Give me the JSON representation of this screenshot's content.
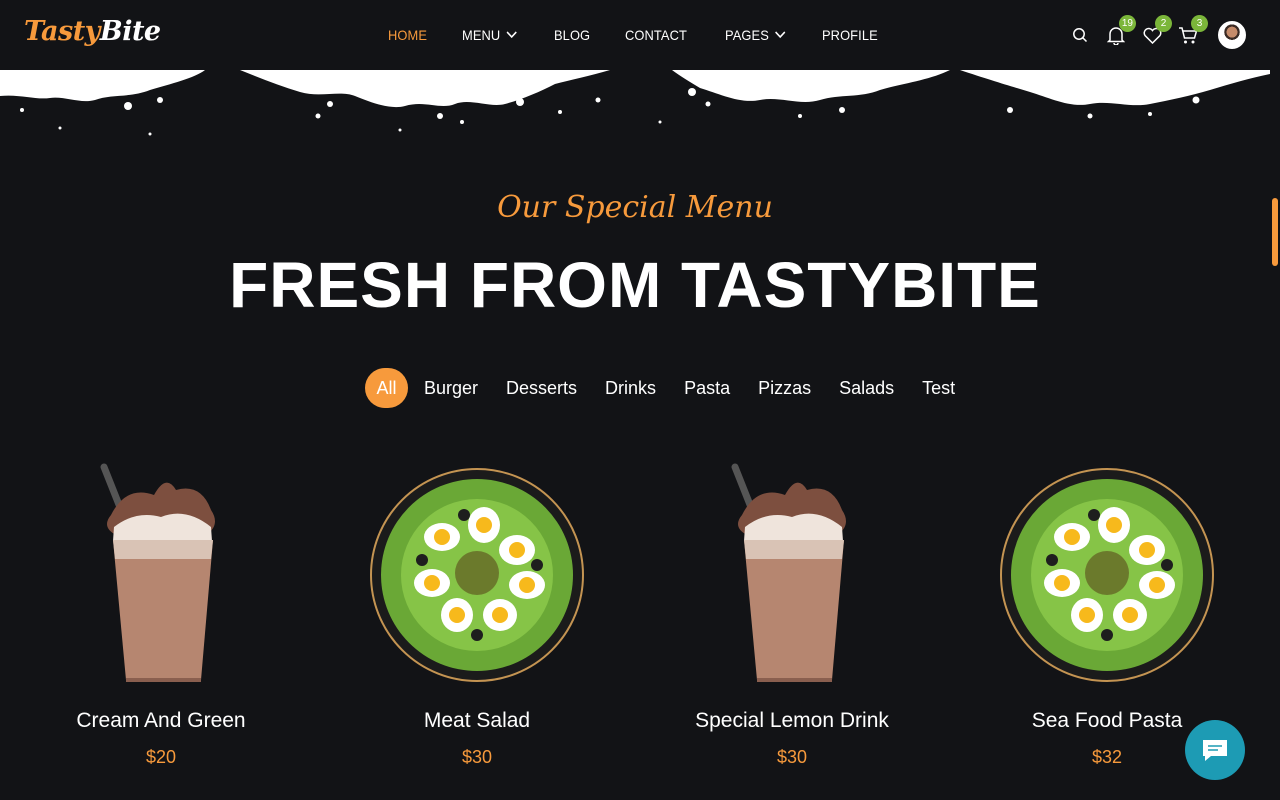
{
  "header": {
    "logo": {
      "part1": "Tasty",
      "part2": "Bite"
    },
    "nav": [
      {
        "label": "HOME",
        "active": true
      },
      {
        "label": "MENU",
        "dropdown": true
      },
      {
        "label": "BLOG"
      },
      {
        "label": "CONTACT"
      },
      {
        "label": "PAGES",
        "dropdown": true
      },
      {
        "label": "PROFILE"
      }
    ],
    "icons": {
      "search": "search-icon",
      "notifications": {
        "icon": "bell-icon",
        "count": "19"
      },
      "wishlist": {
        "icon": "heart-icon",
        "count": "2"
      },
      "cart": {
        "icon": "cart-icon",
        "count": "3"
      },
      "avatar": "user-avatar"
    }
  },
  "section": {
    "subtitle": "Our Special Menu",
    "title": "FRESH FROM TASTYBITE"
  },
  "filters": [
    "All",
    "Burger",
    "Desserts",
    "Drinks",
    "Pasta",
    "Pizzas",
    "Salads",
    "Test"
  ],
  "active_filter": "All",
  "products": [
    {
      "name": "Cream And Green",
      "price": "$20",
      "image": "milkshake"
    },
    {
      "name": "Meat Salad",
      "price": "$30",
      "image": "egg-salad"
    },
    {
      "name": "Special Lemon Drink",
      "price": "$30",
      "image": "milkshake"
    },
    {
      "name": "Sea Food Pasta",
      "price": "$32",
      "image": "egg-salad"
    }
  ],
  "colors": {
    "accent": "#f79a3c",
    "background": "#121316",
    "badge": "#7bb63a",
    "chat": "#1d9bb4"
  }
}
